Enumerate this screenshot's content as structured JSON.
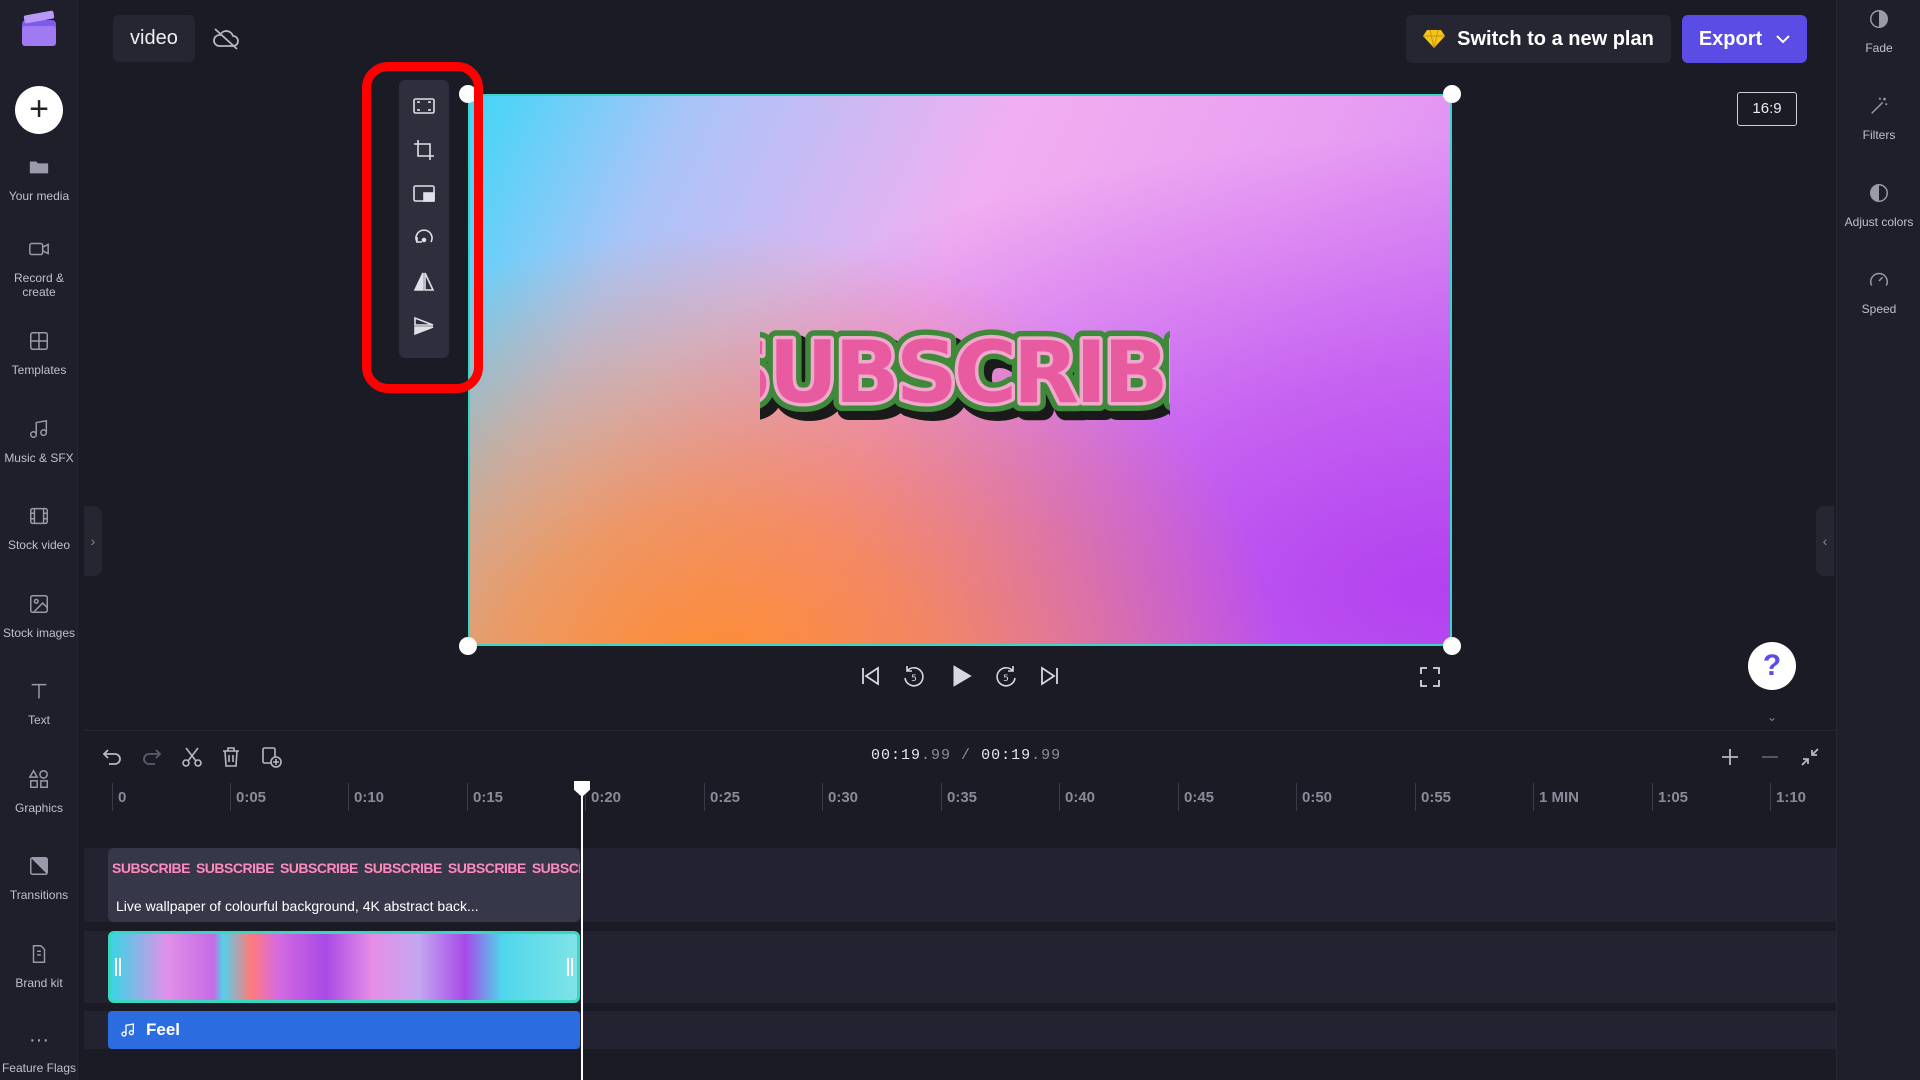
{
  "project": {
    "title": "video"
  },
  "left_sidebar": [
    {
      "label": "Your media"
    },
    {
      "label": "Record &\ncreate"
    },
    {
      "label": "Templates"
    },
    {
      "label": "Music & SFX"
    },
    {
      "label": "Stock video"
    },
    {
      "label": "Stock images"
    },
    {
      "label": "Text"
    },
    {
      "label": "Graphics"
    },
    {
      "label": "Transitions"
    },
    {
      "label": "Brand kit"
    },
    {
      "label": "Feature Flags"
    }
  ],
  "right_sidebar": [
    {
      "label": "Fade"
    },
    {
      "label": "Filters"
    },
    {
      "label": "Adjust colors"
    },
    {
      "label": "Speed"
    }
  ],
  "header": {
    "plan_label": "Switch to a new plan",
    "export_label": "Export"
  },
  "preview": {
    "aspect_ratio": "16:9",
    "overlay_text": "SUBSCRIBE",
    "accent_color": "#36d7c6"
  },
  "floating_toolbar": [
    "fit-icon",
    "crop-icon",
    "pip-icon",
    "rotate-icon",
    "flip-horizontal-icon",
    "flip-vertical-icon"
  ],
  "timeline": {
    "current": "00:19",
    "current_frac": ".99",
    "total": "00:19",
    "total_frac": ".99",
    "ruler": [
      "0",
      "0:05",
      "0:10",
      "0:15",
      "0:20",
      "0:25",
      "0:30",
      "0:35",
      "0:40",
      "0:45",
      "0:50",
      "0:55",
      "1 MIN",
      "1:05",
      "1:10"
    ],
    "text_clip_label": "Live wallpaper of colourful background, 4K abstract back...",
    "text_clip_thumb": "SUBSCRIBE",
    "audio_clip_label": "Feel"
  },
  "colors": {
    "accent": "#5b4ce6",
    "highlight": "#ff0000",
    "audio": "#2b6de0"
  }
}
